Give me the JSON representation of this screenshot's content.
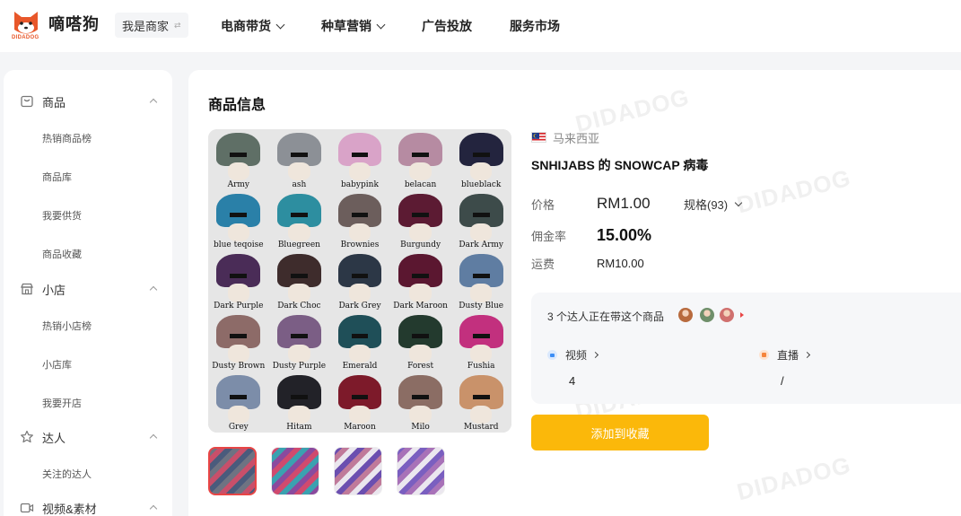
{
  "header": {
    "logo_name": "嘀嗒狗",
    "logo_sub": "DIDADOG",
    "merchant_label": "我是商家",
    "merchant_swap_icon": "⇄",
    "nav": [
      {
        "label": "电商带货",
        "has_dropdown": true
      },
      {
        "label": "种草营销",
        "has_dropdown": true
      },
      {
        "label": "广告投放",
        "has_dropdown": false
      },
      {
        "label": "服务市场",
        "has_dropdown": false
      }
    ]
  },
  "sidebar": {
    "sections": [
      {
        "label": "商品",
        "icon": "box-icon",
        "items": [
          "热销商品榜",
          "商品库",
          "我要供货",
          "商品收藏"
        ]
      },
      {
        "label": "小店",
        "icon": "store-icon",
        "items": [
          "热销小店榜",
          "小店库",
          "我要开店"
        ]
      },
      {
        "label": "达人",
        "icon": "star-user-icon",
        "items": [
          "关注的达人"
        ]
      },
      {
        "label": "视频&素材",
        "icon": "video-icon",
        "items": []
      }
    ]
  },
  "watermark": "DIDADOG",
  "main": {
    "title": "商品信息",
    "product": {
      "region": "马来西亚",
      "name": "SNHIJABS 的 SNOWCAP 病毒",
      "price_label": "价格",
      "price": "RM1.00",
      "spec": "规格(93)",
      "commission_label": "佣金率",
      "commission": "15.00%",
      "shipping_label": "运费",
      "shipping": "RM10.00"
    },
    "swatches": [
      {
        "name": "Army",
        "color": "#5f6f66"
      },
      {
        "name": "ash",
        "color": "#8c9096"
      },
      {
        "name": "babypink",
        "color": "#d9a3c8"
      },
      {
        "name": "belacan",
        "color": "#b68ba2"
      },
      {
        "name": "blueblack",
        "color": "#23243e"
      },
      {
        "name": "blue teqoise",
        "color": "#2a80a8"
      },
      {
        "name": "Bluegreen",
        "color": "#2d8ea0"
      },
      {
        "name": "Brownies",
        "color": "#6c5e5c"
      },
      {
        "name": "Burgundy",
        "color": "#5c1b33"
      },
      {
        "name": "Dark Army",
        "color": "#3d4b4a"
      },
      {
        "name": "Dark Purple",
        "color": "#4a2c57"
      },
      {
        "name": "Dark Choc",
        "color": "#3e2c2c"
      },
      {
        "name": "Dark Grey",
        "color": "#2c3746"
      },
      {
        "name": "Dark Maroon",
        "color": "#5b1730"
      },
      {
        "name": "Dusty Blue",
        "color": "#5f7da2"
      },
      {
        "name": "Dusty Brown",
        "color": "#8d6b68"
      },
      {
        "name": "Dusty Purple",
        "color": "#7b5e85"
      },
      {
        "name": "Emerald",
        "color": "#1f4f58"
      },
      {
        "name": "Forest",
        "color": "#233a2e"
      },
      {
        "name": "Fushia",
        "color": "#c2307e"
      },
      {
        "name": "Grey",
        "color": "#7c8da9"
      },
      {
        "name": "Hitam",
        "color": "#222228"
      },
      {
        "name": "Maroon",
        "color": "#7d1a2a"
      },
      {
        "name": "Milo",
        "color": "#8b6d64"
      },
      {
        "name": "Mustard",
        "color": "#c9926a"
      }
    ],
    "thumbnails": [
      {
        "name": "thumb-1",
        "colors": [
          "#6e7382",
          "#c84f6a",
          "#4a5b7c"
        ]
      },
      {
        "name": "thumb-2",
        "colors": [
          "#d04a6e",
          "#3aa1b0",
          "#8a4a9e"
        ]
      },
      {
        "name": "thumb-3",
        "colors": [
          "#6b4fb0",
          "#c07a9a",
          "#eae6ee"
        ]
      },
      {
        "name": "thumb-4",
        "colors": [
          "#7a5fc0",
          "#a872b8",
          "#ebe7ef"
        ]
      }
    ],
    "kol": {
      "text": "3 个达人正在带这个商品",
      "avatar_colors": [
        "#b86a3d",
        "#6f8f6a",
        "#d0706e"
      ],
      "more_icon": "caret-right-icon",
      "video_label": "视频",
      "video_value": "4",
      "live_label": "直播",
      "live_value": "/"
    },
    "favorite_button": "添加到收藏"
  },
  "colors": {
    "accent": "#fbb80a",
    "logo_orange": "#e8572a",
    "video_icon": "#3d8ef5",
    "live_icon": "#f5853d"
  }
}
